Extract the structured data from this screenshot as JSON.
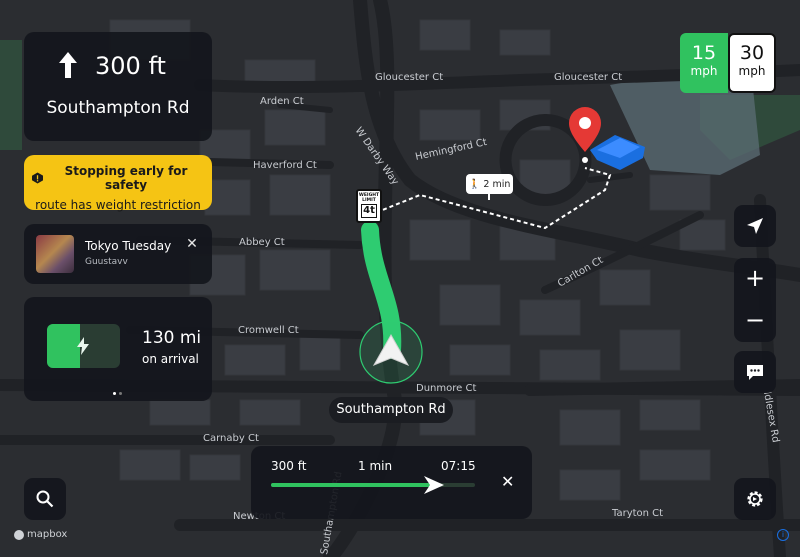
{
  "maneuver": {
    "distance": "300 ft",
    "street": "Southampton Rd"
  },
  "alert": {
    "title": "Stopping early for safety",
    "subtitle": "route has weight restriction"
  },
  "media": {
    "title": "Tokyo Tuesday",
    "artist": "Guustavv"
  },
  "battery": {
    "range": "130 mi",
    "label": "on arrival",
    "charge_fraction": 0.45
  },
  "speed": {
    "current_value": "15",
    "current_unit": "mph",
    "limit_value": "30",
    "limit_unit": "mph"
  },
  "trip": {
    "distance": "300 ft",
    "time": "1 min",
    "eta": "07:15",
    "progress": 0.8
  },
  "current_road": "Southampton Rd",
  "walk_badge": "2 min",
  "weight_sign": {
    "line1": "WEIGHT",
    "line2": "LIMIT",
    "value": "4t"
  },
  "streets": {
    "gloucester_1": "Gloucester Ct",
    "gloucester_2": "Gloucester Ct",
    "arden": "Arden Ct",
    "darby": "W Darby Way",
    "hemingford": "Hemingford Ct",
    "haverford": "Haverford Ct",
    "abbey": "Abbey Ct",
    "carlton": "Carlton Ct",
    "cromwell": "Cromwell Ct",
    "dunmore": "Dunmore Ct",
    "carnaby": "Carnaby Ct",
    "newton": "Newton Ct",
    "taryton": "Taryton Ct",
    "idlesex": "Idlesex Rd",
    "southampton_vertical": "Southampton Rd"
  },
  "attribution": "mapbox",
  "colors": {
    "route": "#2ecc71",
    "accent_green": "#30c25f",
    "warning": "#f5c414",
    "pin": "#e53935",
    "building_highlight": "#1a6fe0"
  }
}
